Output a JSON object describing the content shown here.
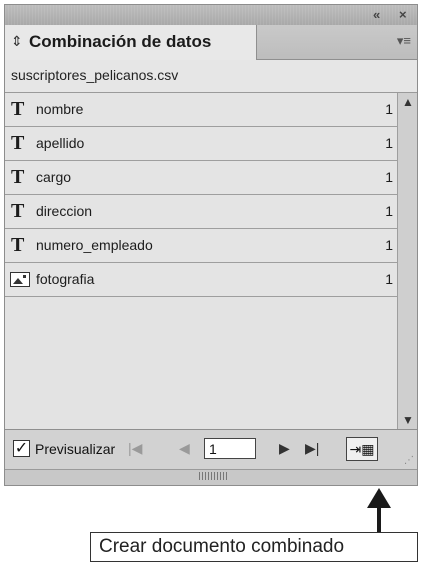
{
  "titlebar": {
    "collapse_icon": "«",
    "close_icon": "×"
  },
  "tab": {
    "updown_icon": "⇕",
    "label": "Combinación de datos",
    "menu_icon": "▾≡"
  },
  "source_file": "suscriptores_pelicanos.csv",
  "fields": [
    {
      "name": "nombre",
      "count": "1",
      "icon": "text-icon",
      "glyph": "T"
    },
    {
      "name": "apellido",
      "count": "1",
      "icon": "text-icon",
      "glyph": "T"
    },
    {
      "name": "cargo",
      "count": "1",
      "icon": "text-icon",
      "glyph": "T"
    },
    {
      "name": "direccion",
      "count": "1",
      "icon": "text-icon",
      "glyph": "T"
    },
    {
      "name": "numero_empleado",
      "count": "1",
      "icon": "text-icon",
      "glyph": "T"
    },
    {
      "name": "fotografia",
      "count": "1",
      "icon": "image-icon",
      "glyph": ""
    }
  ],
  "scrollbar": {
    "up_icon": "▲",
    "down_icon": "▼"
  },
  "bottombar": {
    "preview_checked": true,
    "checkmark": "✓",
    "preview_label": "Previsualizar",
    "first_icon": "|◀",
    "prev_icon": "◀",
    "page_value": "1",
    "next_icon": "▶",
    "last_icon": "▶|",
    "create_icon": "⇥▦",
    "grip": "⋰"
  },
  "tooltip": "Crear documento combinado"
}
